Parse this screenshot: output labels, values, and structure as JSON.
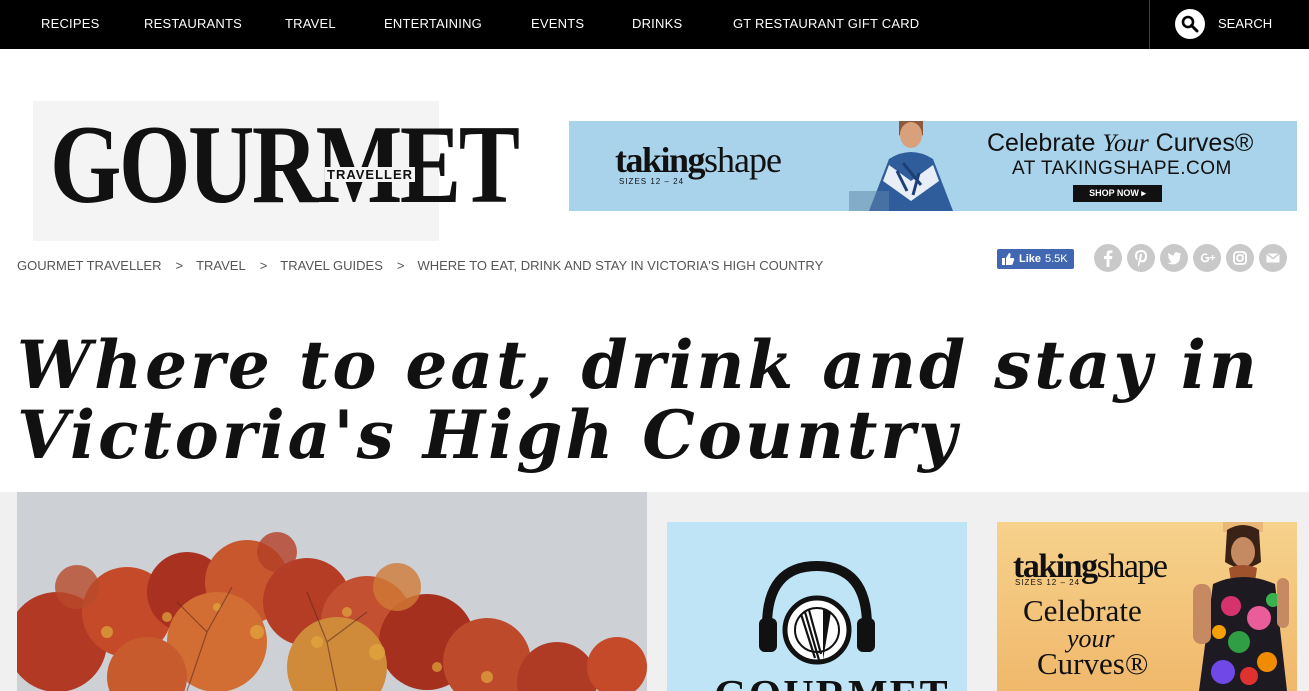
{
  "nav": {
    "items": [
      "RECIPES",
      "RESTAURANTS",
      "TRAVEL",
      "ENTERTAINING",
      "EVENTS",
      "DRINKS",
      "GT RESTAURANT GIFT CARD"
    ],
    "search_label": "SEARCH"
  },
  "logo": {
    "main": "GOURMET",
    "sub": "TRAVELLER"
  },
  "ad_top": {
    "brand_bold": "taking",
    "brand_light": "shape",
    "sizes": "SIZES 12 – 24",
    "tagline_pre": "Celebrate ",
    "tagline_italic": "Your",
    "tagline_post": " Curves®",
    "site": "AT TAKINGSHAPE.COM",
    "button": "SHOP NOW ▸"
  },
  "breadcrumb": {
    "items": [
      "GOURMET TRAVELLER",
      "TRAVEL",
      "TRAVEL GUIDES"
    ],
    "current": "WHERE TO EAT, DRINK AND STAY IN VICTORIA'S HIGH COUNTRY",
    "separator": ">"
  },
  "social": {
    "like_label": "Like",
    "like_count": "5.5K",
    "icons": [
      "facebook-icon",
      "pinterest-icon",
      "twitter-icon",
      "google-plus-icon",
      "instagram-icon",
      "email-icon"
    ]
  },
  "article": {
    "title": "Where to eat, drink and stay in Victoria's High Country"
  },
  "podcast": {
    "word": "GOURMET"
  },
  "ad_side": {
    "brand_bold": "taking",
    "brand_light": "shape",
    "sizes": "SIZES 12 – 24",
    "line1": "Celebrate",
    "line2": "your",
    "line3": "Curves®"
  },
  "colors": {
    "nav_bg": "#000000",
    "like_blue": "#4267b2",
    "ad_blue": "#a9d3ea",
    "podcast_blue": "#bfe4f6",
    "ad_gold": "#f0b86b"
  }
}
